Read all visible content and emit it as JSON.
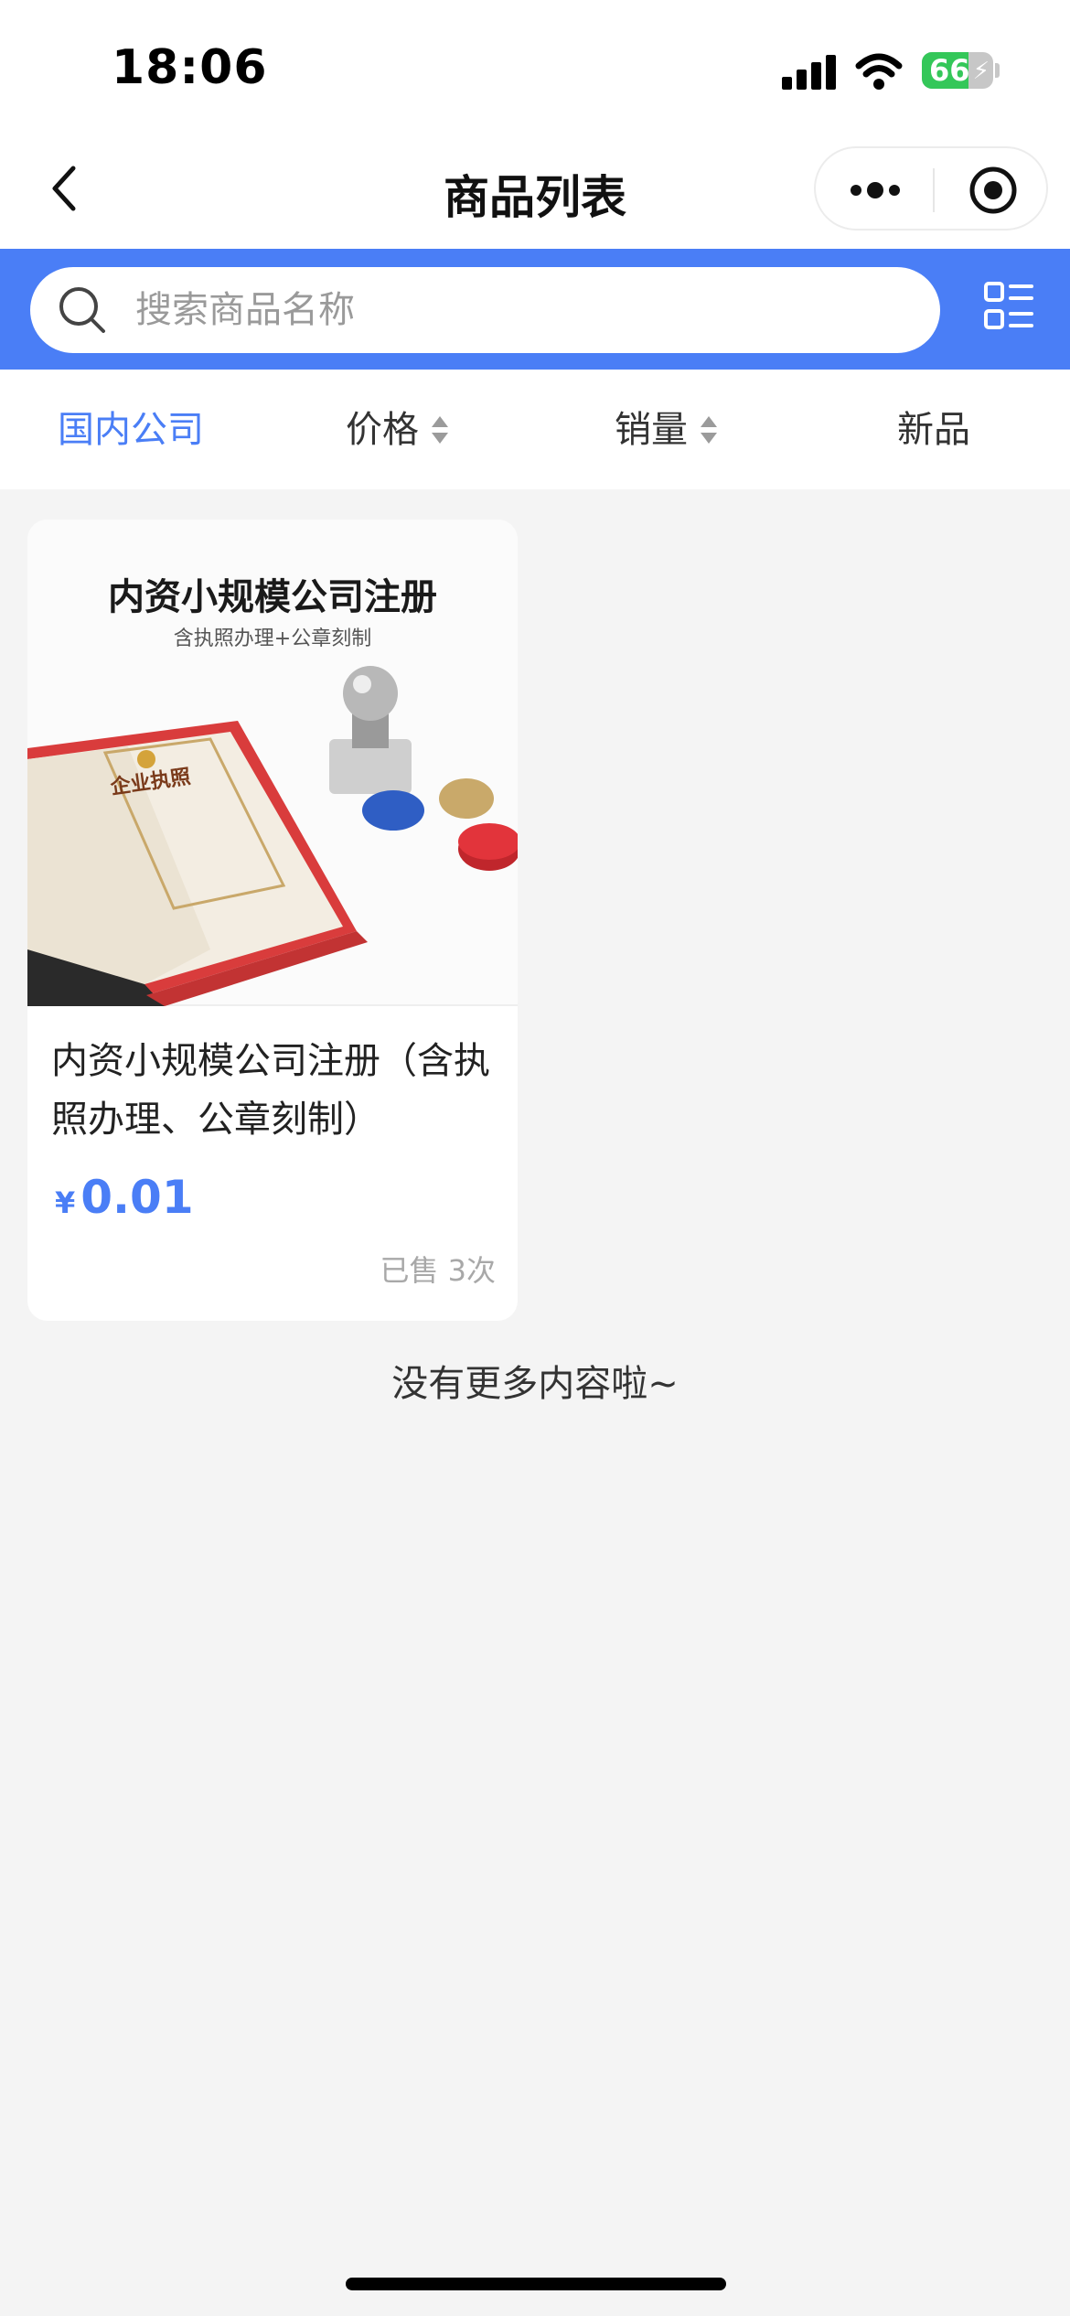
{
  "status_bar": {
    "time": "18:06",
    "battery": "66",
    "battery_level": 0.66
  },
  "nav": {
    "title": "商品列表"
  },
  "search": {
    "placeholder": "搜索商品名称"
  },
  "filters": [
    {
      "label": "国内公司",
      "active": true
    },
    {
      "label": "价格",
      "sortable": true
    },
    {
      "label": "销量",
      "sortable": true
    },
    {
      "label": "新品"
    }
  ],
  "products": [
    {
      "image_title": "内资小规模公司注册",
      "image_subtitle": "含执照办理+公章刻制",
      "image_license_text": "企业执照",
      "title": "内资小规模公司注册（含执照办理、公章刻制）",
      "currency": "¥",
      "price": "0.01",
      "sold": "已售 3次"
    }
  ],
  "footer": {
    "no_more": "没有更多内容啦~"
  },
  "colors": {
    "accent": "#4a7ef6",
    "background": "#f4f4f4",
    "battery_green": "#34c759"
  },
  "icons": [
    "back-arrow-icon",
    "more-dots-icon",
    "close-target-icon",
    "search-icon",
    "list-layout-icon",
    "sort-arrows-icon"
  ]
}
